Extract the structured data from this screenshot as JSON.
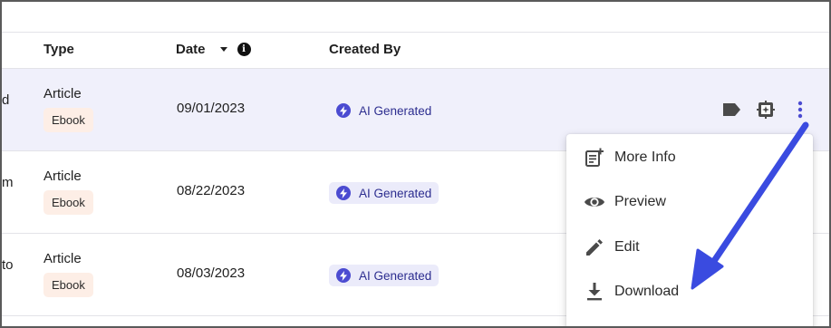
{
  "table": {
    "columns": {
      "type": "Type",
      "date": "Date",
      "created_by": "Created By"
    },
    "rows": [
      {
        "title_fragment": "d",
        "type": "Article",
        "badge": "Ebook",
        "date": "09/01/2023",
        "created_by": "AI Generated",
        "selected": true
      },
      {
        "title_fragment": "m",
        "type": "Article",
        "badge": "Ebook",
        "date": "08/22/2023",
        "created_by": "AI Generated",
        "selected": false
      },
      {
        "title_fragment": "to",
        "type": "Article",
        "badge": "Ebook",
        "date": "08/03/2023",
        "created_by": "AI Generated",
        "selected": false
      }
    ]
  },
  "row_actions": {
    "icons": [
      "label-icon",
      "ai-settings-icon",
      "more-vertical-icon"
    ]
  },
  "menu": {
    "items": [
      {
        "label": "More Info",
        "icon": "note-add-icon"
      },
      {
        "label": "Preview",
        "icon": "eye-icon"
      },
      {
        "label": "Edit",
        "icon": "pencil-icon"
      },
      {
        "label": "Download",
        "icon": "download-icon"
      }
    ]
  },
  "colors": {
    "accent": "#4b4bd1",
    "selected_row": "#f0f0fb",
    "ai_badge_bg": "#ebebfa",
    "ai_badge_text": "#2c2d8f",
    "ebook_badge_bg": "#fdeee6",
    "annotation_arrow": "#3a4be0"
  }
}
